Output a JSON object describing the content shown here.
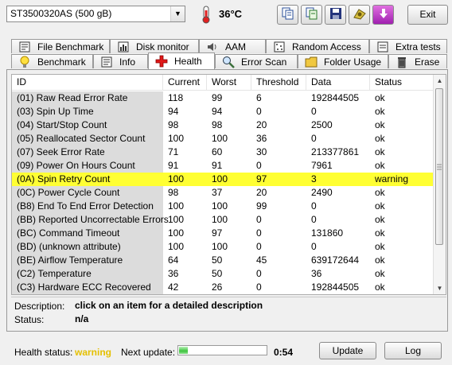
{
  "toolbar": {
    "drive": "ST3500320AS (500 gB)",
    "temperature": "36°C",
    "exit_label": "Exit"
  },
  "tabs_row1": [
    {
      "label": "File Benchmark",
      "icon": "file-benchmark-icon"
    },
    {
      "label": "Disk monitor",
      "icon": "disk-monitor-icon"
    },
    {
      "label": "AAM",
      "icon": "speaker-icon"
    },
    {
      "label": "Random Access",
      "icon": "random-access-icon"
    },
    {
      "label": "Extra tests",
      "icon": "extra-tests-icon"
    }
  ],
  "tabs_row2": [
    {
      "label": "Benchmark",
      "icon": "benchmark-icon"
    },
    {
      "label": "Info",
      "icon": "info-icon"
    },
    {
      "label": "Health",
      "icon": "health-cross-icon",
      "active": true
    },
    {
      "label": "Error Scan",
      "icon": "magnifier-icon"
    },
    {
      "label": "Folder Usage",
      "icon": "folder-icon"
    },
    {
      "label": "Erase",
      "icon": "trash-icon"
    }
  ],
  "table": {
    "columns": [
      "ID",
      "Current",
      "Worst",
      "Threshold",
      "Data",
      "Status"
    ],
    "rows": [
      [
        "(01) Raw Read Error Rate",
        "118",
        "99",
        "6",
        "192844505",
        "ok"
      ],
      [
        "(03) Spin Up Time",
        "94",
        "94",
        "0",
        "0",
        "ok"
      ],
      [
        "(04) Start/Stop Count",
        "98",
        "98",
        "20",
        "2500",
        "ok"
      ],
      [
        "(05) Reallocated Sector Count",
        "100",
        "100",
        "36",
        "0",
        "ok"
      ],
      [
        "(07) Seek Error Rate",
        "71",
        "60",
        "30",
        "213377861",
        "ok"
      ],
      [
        "(09) Power On Hours Count",
        "91",
        "91",
        "0",
        "7961",
        "ok"
      ],
      [
        "(0A) Spin Retry Count",
        "100",
        "100",
        "97",
        "3",
        "warning"
      ],
      [
        "(0C) Power Cycle Count",
        "98",
        "37",
        "20",
        "2490",
        "ok"
      ],
      [
        "(B8) End To End Error Detection",
        "100",
        "100",
        "99",
        "0",
        "ok"
      ],
      [
        "(BB) Reported Uncorrectable Errors",
        "100",
        "100",
        "0",
        "0",
        "ok"
      ],
      [
        "(BC) Command Timeout",
        "100",
        "97",
        "0",
        "131860",
        "ok"
      ],
      [
        "(BD) (unknown attribute)",
        "100",
        "100",
        "0",
        "0",
        "ok"
      ],
      [
        "(BE) Airflow Temperature",
        "64",
        "50",
        "45",
        "639172644",
        "ok"
      ],
      [
        "(C2) Temperature",
        "36",
        "50",
        "0",
        "36",
        "ok"
      ],
      [
        "(C3) Hardware ECC Recovered",
        "42",
        "26",
        "0",
        "192844505",
        "ok"
      ]
    ]
  },
  "details": {
    "description_label": "Description:",
    "description_value": "click on an item for a detailed description",
    "status_label": "Status:",
    "status_value": "n/a"
  },
  "footer": {
    "health_label": "Health status:",
    "health_value": "warning",
    "next_update_label": "Next update:",
    "progress_fraction": 0.1,
    "countdown": "0:54",
    "update_label": "Update",
    "log_label": "Log"
  },
  "colors": {
    "warning_row": "#ffff33",
    "warning_text": "#e5c000"
  }
}
